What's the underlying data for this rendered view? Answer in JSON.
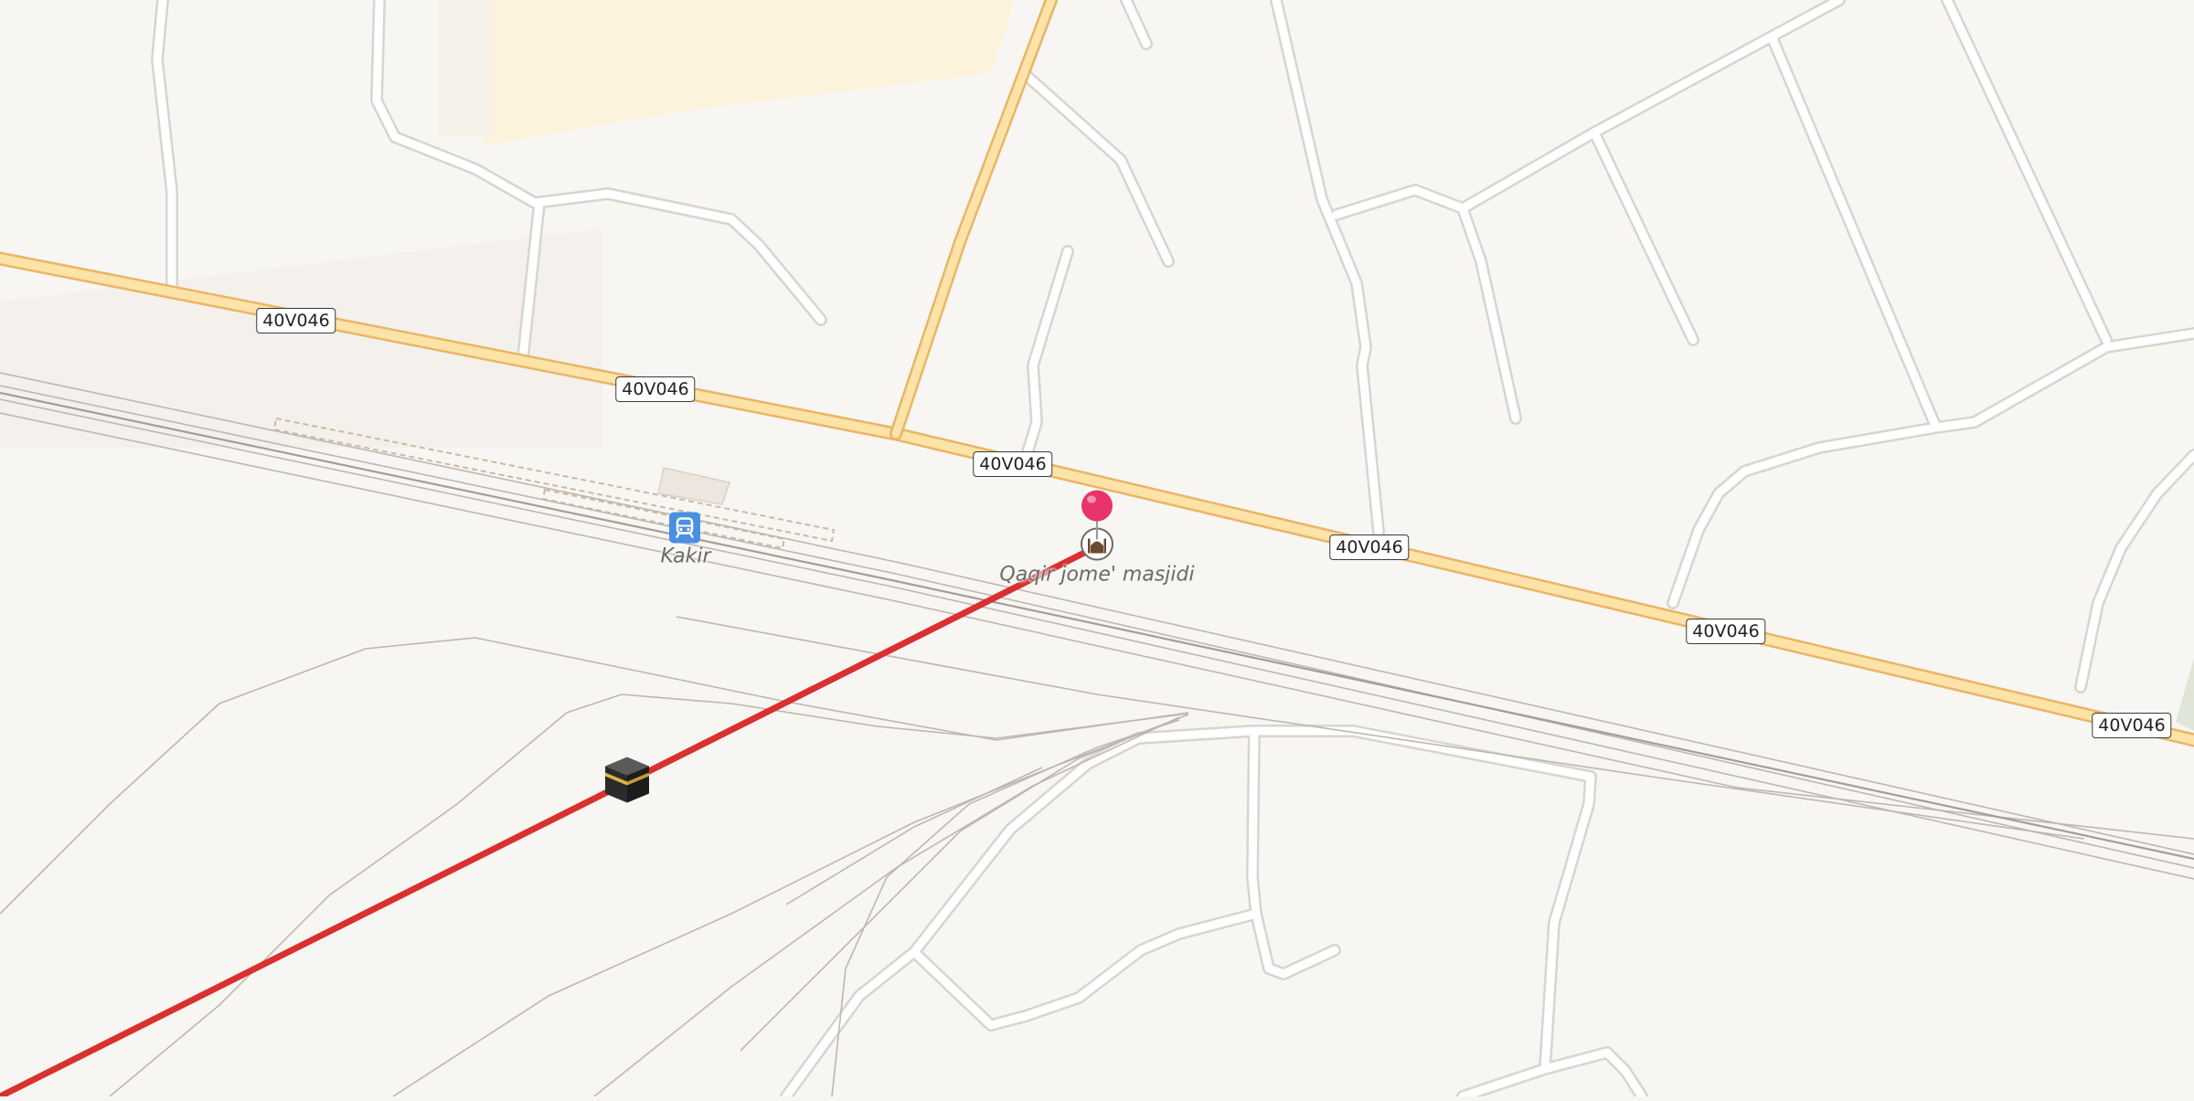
{
  "map": {
    "road_ref": "40V046",
    "road_labels": [
      "40V046",
      "40V046",
      "40V046",
      "40V046",
      "40V046",
      "40V046"
    ],
    "station": {
      "name": "Kakir",
      "icon": "train-station-icon",
      "color": "#4a90e2"
    },
    "mosque": {
      "name": "Qaqir jome' masjidi",
      "icon": "mosque-icon"
    },
    "marker": {
      "icon": "location-pin-icon",
      "color": "#e8336b"
    },
    "qibla": {
      "icon": "kaaba-icon",
      "line_color": "#d93030"
    },
    "colors": {
      "background": "#f8f6f3",
      "road_fill": "#fde3a7",
      "road_casing": "#e9b567",
      "minor_road": "#ffffff",
      "minor_road_casing": "#d8d4cf",
      "rail": "#b9b3ad"
    }
  }
}
